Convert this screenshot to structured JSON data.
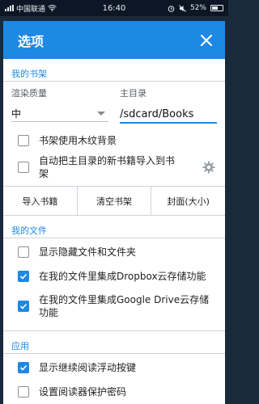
{
  "statusbar": {
    "carrier": "中国联通",
    "time": "16:40",
    "battery": "52%"
  },
  "dialog": {
    "title": "选项",
    "sections": {
      "bookshelf": {
        "header": "我的书架",
        "render_quality": {
          "label": "渲染质量",
          "value": "中"
        },
        "home_dir": {
          "label": "主目录",
          "value": "/sdcard/Books"
        },
        "wood_bg": {
          "label": "书架使用木纹背景",
          "checked": false
        },
        "auto_import": {
          "label": "自动把主目录的新书籍导入到书架",
          "checked": false
        },
        "buttons": {
          "import": "导入书籍",
          "clear": "清空书架",
          "cover": "封面(大小)"
        }
      },
      "files": {
        "header": "我的文件",
        "show_hidden": {
          "label": "显示隐藏文件和文件夹",
          "checked": false
        },
        "dropbox": {
          "label": "在我的文件里集成Dropbox云存储功能",
          "checked": true
        },
        "gdrive": {
          "label": "在我的文件里集成Google Drive云存储功能",
          "checked": true
        }
      },
      "app": {
        "header": "应用",
        "float_btn": {
          "label": "显示继续阅读浮动按键",
          "checked": true
        },
        "password": {
          "label": "设置阅读器保护密码",
          "checked": false
        }
      }
    }
  },
  "colors": {
    "accent": "#1e88e5",
    "statusbar": "#0c1624"
  },
  "icons": {
    "close": "close-icon",
    "gear": "gear-icon",
    "check": "checkmark-icon"
  }
}
